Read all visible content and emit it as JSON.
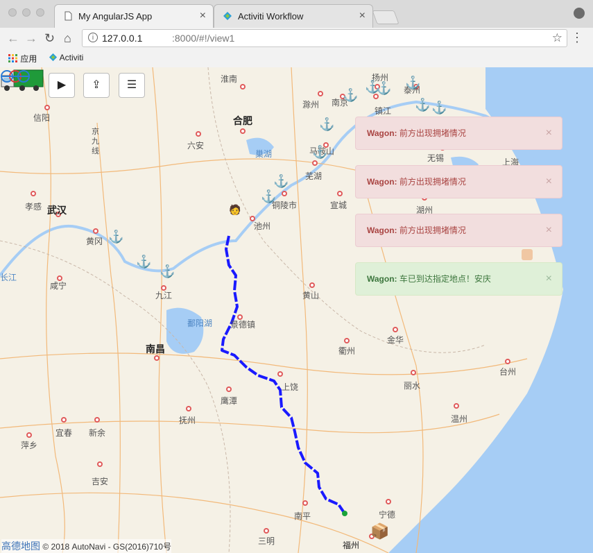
{
  "browser": {
    "tabs": [
      {
        "title": "My AngularJS App",
        "close": "×"
      },
      {
        "title": "Activiti Workflow",
        "close": "×"
      }
    ],
    "url_host": "127.0.0.1",
    "url_path": ":8000/#!/view1",
    "nav": {
      "back": "←",
      "forward": "→",
      "reload": "↻",
      "home": "⌂",
      "star": "☆",
      "menu": "⋮",
      "info": "i"
    },
    "bookmarks": [
      {
        "label": "应用",
        "icon": "apps-grid-icon"
      },
      {
        "label": "Activiti",
        "icon": "activiti-diamond-icon"
      }
    ]
  },
  "map_controls": {
    "play": "▶",
    "upload": "⇪",
    "menu": "☰"
  },
  "cities": [
    {
      "name": "淮南",
      "big": false
    },
    {
      "name": "扬州",
      "big": false
    },
    {
      "name": "信阳",
      "big": false
    },
    {
      "name": "合肥",
      "big": true
    },
    {
      "name": "滁州",
      "big": false
    },
    {
      "name": "南京",
      "big": false
    },
    {
      "name": "镇江",
      "big": false
    },
    {
      "name": "泰州",
      "big": false
    },
    {
      "name": "六安",
      "big": false
    },
    {
      "name": "巢湖",
      "big": false
    },
    {
      "name": "马鞍山",
      "big": false
    },
    {
      "name": "芜湖",
      "big": false
    },
    {
      "name": "无锡",
      "big": false
    },
    {
      "name": "上海",
      "big": false
    },
    {
      "name": "孝感",
      "big": false
    },
    {
      "name": "武汉",
      "big": true
    },
    {
      "name": "铜陵市",
      "big": false
    },
    {
      "name": "宣城",
      "big": false
    },
    {
      "name": "湖州",
      "big": false
    },
    {
      "name": "池州",
      "big": false
    },
    {
      "name": "黄冈",
      "big": false
    },
    {
      "name": "长江",
      "big": false
    },
    {
      "name": "咸宁",
      "big": false
    },
    {
      "name": "九江",
      "big": false
    },
    {
      "name": "黄山",
      "big": false
    },
    {
      "name": "鄱阳湖",
      "big": false
    },
    {
      "name": "景德镇",
      "big": false
    },
    {
      "name": "南昌",
      "big": true
    },
    {
      "name": "金华",
      "big": false
    },
    {
      "name": "衢州",
      "big": false
    },
    {
      "name": "台州",
      "big": false
    },
    {
      "name": "上饶",
      "big": false
    },
    {
      "name": "丽水",
      "big": false
    },
    {
      "name": "鹰潭",
      "big": false
    },
    {
      "name": "抚州",
      "big": false
    },
    {
      "name": "温州",
      "big": false
    },
    {
      "name": "萍乡",
      "big": false
    },
    {
      "name": "宜春",
      "big": false
    },
    {
      "name": "新余",
      "big": false
    },
    {
      "name": "吉安",
      "big": false
    },
    {
      "name": "南平",
      "big": false
    },
    {
      "name": "宁德",
      "big": false
    },
    {
      "name": "三明",
      "big": false
    },
    {
      "name": "福州",
      "big": false
    },
    {
      "name": "京九线",
      "big": false
    }
  ],
  "alerts": [
    {
      "label": "Wagon:",
      "message": "前方出现拥堵情况",
      "type": "danger",
      "close": "×"
    },
    {
      "label": "Wagon:",
      "message": "前方出现拥堵情况",
      "type": "danger",
      "close": "×"
    },
    {
      "label": "Wagon:",
      "message": "前方出现拥堵情况",
      "type": "danger",
      "close": "×"
    },
    {
      "label": "Wagon:",
      "message": "车已到达指定地点！安庆",
      "type": "success",
      "close": "×"
    }
  ],
  "copyright": {
    "brand": "高德地图",
    "text": "© 2018 AutoNavi - GS(2016)710号"
  },
  "colors": {
    "route": "#1a1aff",
    "water": "#a6cdf5",
    "land": "#f5f1e6",
    "road": "#f2b97a"
  }
}
